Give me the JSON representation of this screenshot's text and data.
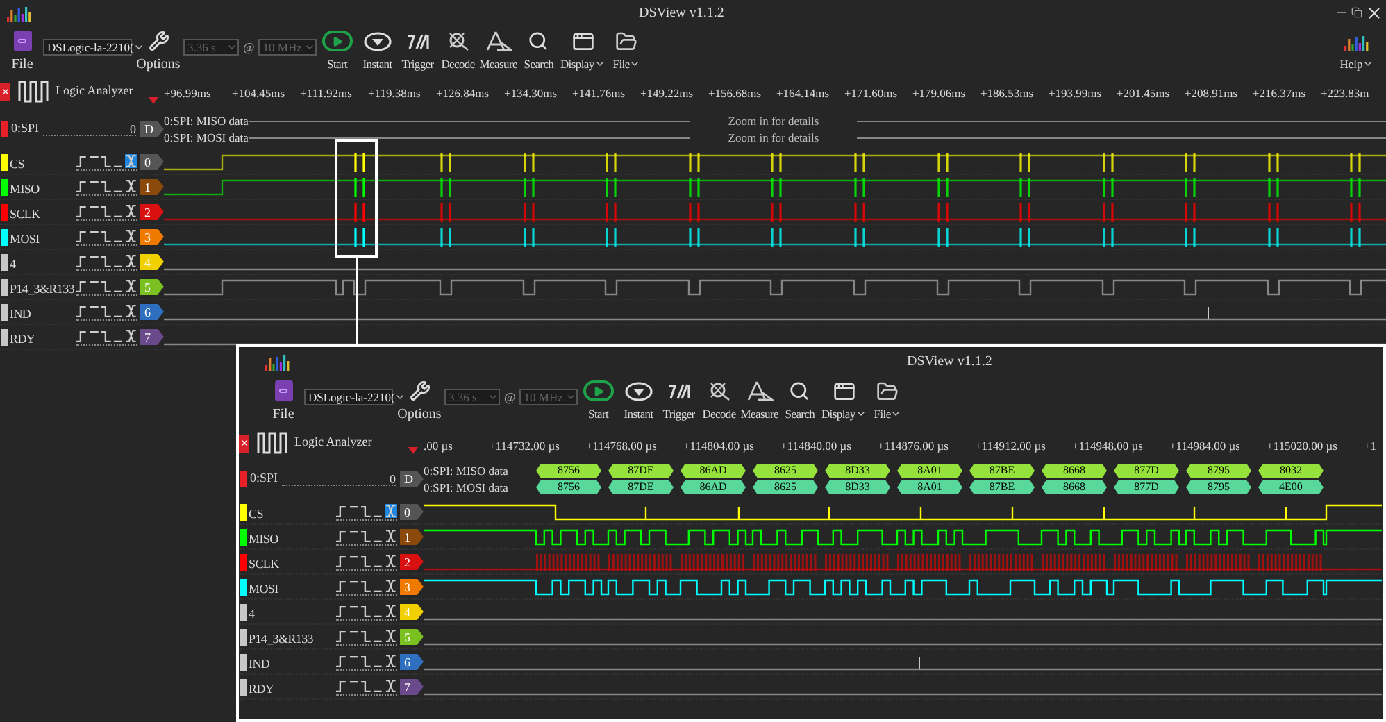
{
  "overview": {
    "kind": "overview",
    "title": "DSView v1.1.2",
    "window_controls": true,
    "toolbar": {
      "file": "File",
      "device": "DSLogic-la-2210(",
      "options": "Options",
      "duration": {
        "value": "3.36 s",
        "disabled": true
      },
      "at": "@",
      "rate": {
        "value": "10 MHz",
        "disabled": true
      },
      "tools": [
        {
          "label": "Start",
          "menu": false
        },
        {
          "label": "Instant",
          "menu": false
        },
        {
          "label": "Trigger",
          "menu": false
        },
        {
          "label": "Decode",
          "menu": false
        },
        {
          "label": "Measure",
          "menu": false
        },
        {
          "label": "Search",
          "menu": false
        },
        {
          "label": "Display",
          "menu": true
        },
        {
          "label": "File",
          "menu": true
        }
      ]
    },
    "help": {
      "label": "Help",
      "menu": true
    },
    "ruler": {
      "title": "Logic Analyzer",
      "ticks": [
        "+96.99ms",
        "+104.45ms",
        "+111.92ms",
        "+119.38ms",
        "+126.84ms",
        "+134.30ms",
        "+141.76ms",
        "+149.22ms",
        "+156.68ms",
        "+164.14ms",
        "+171.60ms",
        "+179.06ms",
        "+186.53ms",
        "+193.99ms",
        "+201.45ms",
        "+208.91ms",
        "+216.37ms",
        "+223.83m"
      ]
    },
    "decoder": {
      "name": "0:SPI",
      "index": "0",
      "badge": "D",
      "color": "#e8202a",
      "rows": [
        {
          "label": "0:SPI: MISO data",
          "notice": "Zoom in for details"
        },
        {
          "label": "0:SPI: MOSI data",
          "notice": "Zoom in for details"
        }
      ]
    },
    "channels": [
      {
        "name": "CS",
        "color": "#ffff00",
        "index": "0",
        "trigger_any": true
      },
      {
        "name": "MISO",
        "color": "#00ff00",
        "index": "1",
        "trigger_any": false
      },
      {
        "name": "SCLK",
        "color": "#ff0000",
        "index": "2",
        "trigger_any": false
      },
      {
        "name": "MOSI",
        "color": "#00ffff",
        "index": "3",
        "trigger_any": false
      },
      {
        "name": "4",
        "color": "#c8c8c8",
        "index": "4",
        "trigger_any": false
      },
      {
        "name": "P14_3&R133",
        "color": "#c8c8c8",
        "index": "5",
        "trigger_any": false
      },
      {
        "name": "IND",
        "color": "#c8c8c8",
        "index": "6",
        "trigger_any": false
      },
      {
        "name": "RDY",
        "color": "#c8c8c8",
        "index": "7",
        "trigger_any": false
      }
    ]
  },
  "zoomed": {
    "kind": "zoomed",
    "title": "DSView v1.1.2",
    "toolbar": {
      "file": "File",
      "device": "DSLogic-la-2210(",
      "options": "Options",
      "duration": {
        "value": "3.36 s",
        "disabled": true
      },
      "at": "@",
      "rate": {
        "value": "10 MHz",
        "disabled": true
      },
      "tools": [
        {
          "label": "Start",
          "menu": false
        },
        {
          "label": "Instant",
          "menu": false
        },
        {
          "label": "Trigger",
          "menu": false
        },
        {
          "label": "Decode",
          "menu": false
        },
        {
          "label": "Measure",
          "menu": false
        },
        {
          "label": "Search",
          "menu": false
        },
        {
          "label": "Display",
          "menu": true
        },
        {
          "label": "File",
          "menu": true
        }
      ]
    },
    "ruler": {
      "title": "Logic Analyzer",
      "ticks": [
        ".00 µs",
        "+114732.00 µs",
        "+114768.00 µs",
        "+114804.00 µs",
        "+114840.00 µs",
        "+114876.00 µs",
        "+114912.00 µs",
        "+114948.00 µs",
        "+114984.00 µs",
        "+115020.00 µs",
        "+1"
      ]
    },
    "decoder": {
      "name": "0:SPI",
      "index": "0",
      "badge": "D",
      "color": "#e8202a",
      "rows": [
        {
          "label": "0:SPI: MISO data",
          "values": [
            "8756",
            "87DE",
            "86AD",
            "8625",
            "8D33",
            "8A01",
            "87BE",
            "8668",
            "877D",
            "8795",
            "8032"
          ]
        },
        {
          "label": "0:SPI: MOSI data",
          "values": [
            "8756",
            "87DE",
            "86AD",
            "8625",
            "8D33",
            "8A01",
            "87BE",
            "8668",
            "877D",
            "8795",
            "4E00"
          ]
        }
      ]
    },
    "channels": [
      {
        "name": "CS",
        "color": "#ffff00",
        "index": "0",
        "trigger_any": true
      },
      {
        "name": "MISO",
        "color": "#00ff00",
        "index": "1",
        "trigger_any": false
      },
      {
        "name": "SCLK",
        "color": "#ff0000",
        "index": "2",
        "trigger_any": false
      },
      {
        "name": "MOSI",
        "color": "#00ffff",
        "index": "3",
        "trigger_any": false
      },
      {
        "name": "4",
        "color": "#c8c8c8",
        "index": "4",
        "trigger_any": false
      },
      {
        "name": "P14_3&R133",
        "color": "#c8c8c8",
        "index": "5",
        "trigger_any": false
      },
      {
        "name": "IND",
        "color": "#c8c8c8",
        "index": "6",
        "trigger_any": false
      },
      {
        "name": "RDY",
        "color": "#c8c8c8",
        "index": "7",
        "trigger_any": false
      }
    ]
  }
}
